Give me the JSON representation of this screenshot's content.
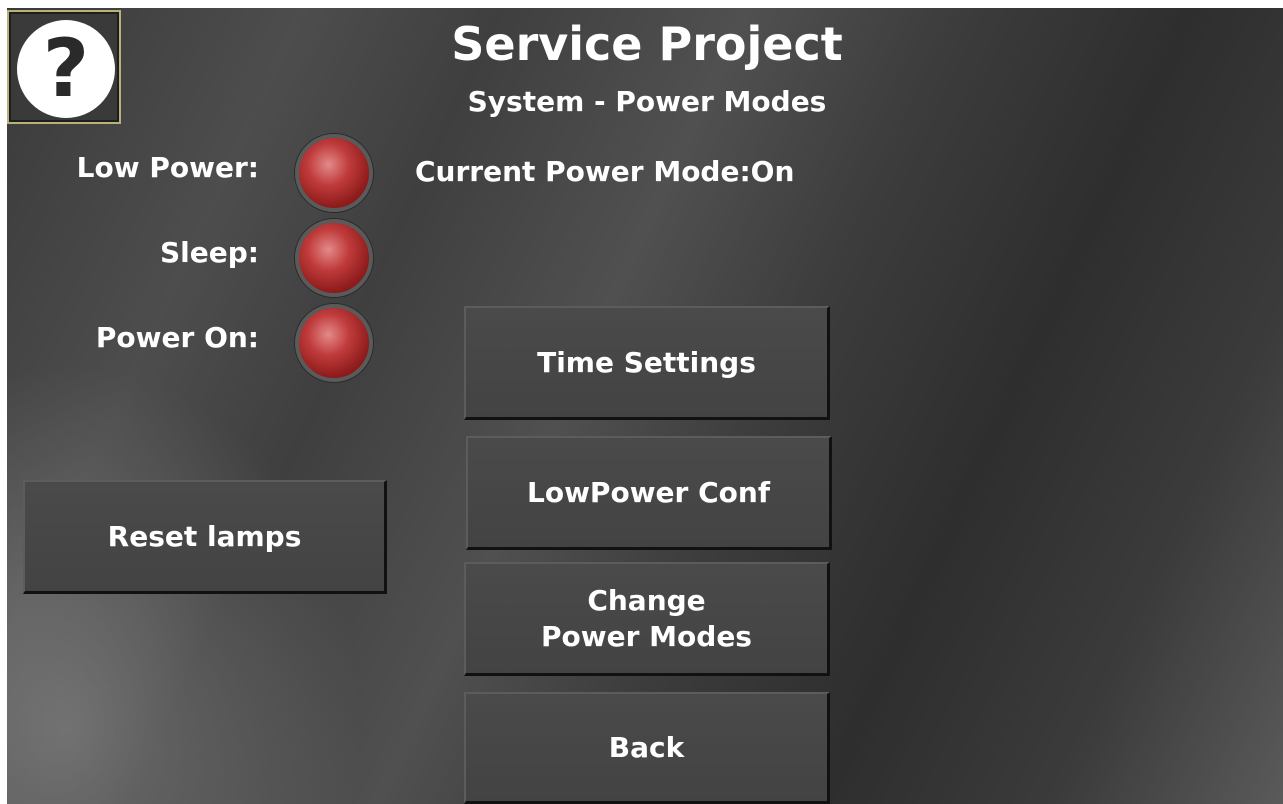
{
  "header": {
    "title": "Service Project",
    "subtitle": "System - Power Modes"
  },
  "help": {
    "glyph": "?"
  },
  "lamps": [
    {
      "label": "Low Power:",
      "state": "off",
      "color": "#c03b3b"
    },
    {
      "label": "Sleep:",
      "state": "off",
      "color": "#c03b3b"
    },
    {
      "label": "Power On:",
      "state": "off",
      "color": "#c03b3b"
    }
  ],
  "status": {
    "current_mode_label": "Current Power Mode:",
    "current_mode_value": "On"
  },
  "buttons": {
    "reset_lamps": "Reset lamps",
    "time_settings": "Time Settings",
    "lowpower_conf": "LowPower Conf",
    "change_power_modes": "Change\nPower Modes",
    "back": "Back"
  }
}
